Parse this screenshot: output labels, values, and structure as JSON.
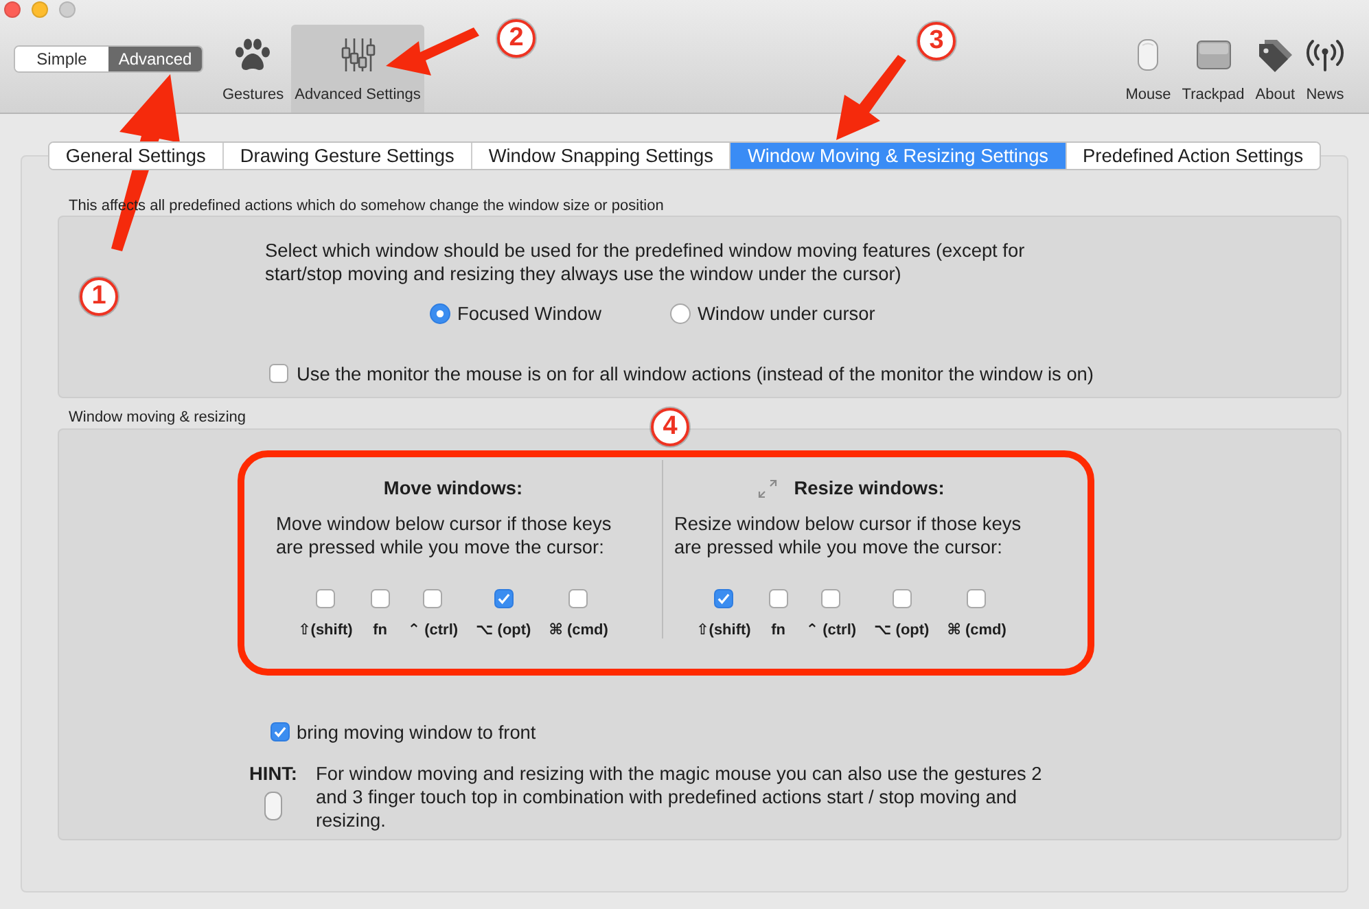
{
  "window_buttons": [
    {
      "kind": "close",
      "disabled": false
    },
    {
      "kind": "minimize",
      "disabled": false
    },
    {
      "kind": "zoom",
      "disabled": true
    }
  ],
  "mode_switch": [
    {
      "label": "Simple",
      "selected": false
    },
    {
      "label": "Advanced",
      "selected": true
    }
  ],
  "toolbar": {
    "items": [
      {
        "kind": "gestures",
        "label": "Gestures",
        "selected": false
      },
      {
        "kind": "advanced",
        "label": "Advanced Settings",
        "selected": true
      }
    ],
    "device_items": [
      {
        "kind": "mouse",
        "label": "Mouse",
        "selected": false
      },
      {
        "kind": "trackpad",
        "label": "Trackpad",
        "selected": false
      },
      {
        "kind": "about",
        "label": "About",
        "selected": false
      },
      {
        "kind": "news",
        "label": "News",
        "selected": false
      }
    ]
  },
  "tabs": [
    {
      "label": "General Settings",
      "selected": false
    },
    {
      "label": "Drawing Gesture Settings",
      "selected": false
    },
    {
      "label": "Window Snapping Settings",
      "selected": false
    },
    {
      "label": "Window Moving & Resizing Settings",
      "selected": true
    },
    {
      "label": "Predefined Action Settings",
      "selected": false
    }
  ],
  "scope_caption": "This affects all predefined actions which do somehow change the window size or position",
  "window_choice": {
    "prompt": "Select which window should be used for the predefined window moving features (except for start/stop moving and resizing they always use the window under the cursor)",
    "options": [
      {
        "label": "Focused Window",
        "selected": true
      },
      {
        "label": "Window under cursor",
        "selected": false
      }
    ],
    "monitor_option": {
      "label": "Use the monitor the mouse is on for all window actions (instead of the monitor the window is on)",
      "checked": false
    }
  },
  "moving_caption": "Window moving & resizing",
  "key_groups": [
    {
      "kind": "move",
      "title": "Move windows:",
      "description": "Move window below cursor if those keys are pressed while you move the cursor:",
      "keys": [
        {
          "label": "⇧(shift)",
          "checked": false
        },
        {
          "label": "fn",
          "checked": false
        },
        {
          "label": "⌃ (ctrl)",
          "checked": false
        },
        {
          "label": "⌥ (opt)",
          "checked": true
        },
        {
          "label": "⌘ (cmd)",
          "checked": false
        }
      ]
    },
    {
      "kind": "resize",
      "title": "Resize windows:",
      "description": "Resize window below cursor if those keys are pressed while you move the cursor:",
      "keys": [
        {
          "label": "⇧(shift)",
          "checked": true
        },
        {
          "label": "fn",
          "checked": false
        },
        {
          "label": "⌃ (ctrl)",
          "checked": false
        },
        {
          "label": "⌥ (opt)",
          "checked": false
        },
        {
          "label": "⌘ (cmd)",
          "checked": false
        }
      ]
    }
  ],
  "bring_to_front": {
    "label": "bring moving window to front",
    "checked": true
  },
  "hint": {
    "label": "HINT:",
    "text": "For window moving and resizing with the magic mouse you can also use the gestures 2 and 3 finger touch top in combination with predefined actions start / stop moving and resizing."
  },
  "annotations": [
    {
      "label": "1"
    },
    {
      "label": "2"
    },
    {
      "label": "3"
    },
    {
      "label": "4"
    }
  ]
}
